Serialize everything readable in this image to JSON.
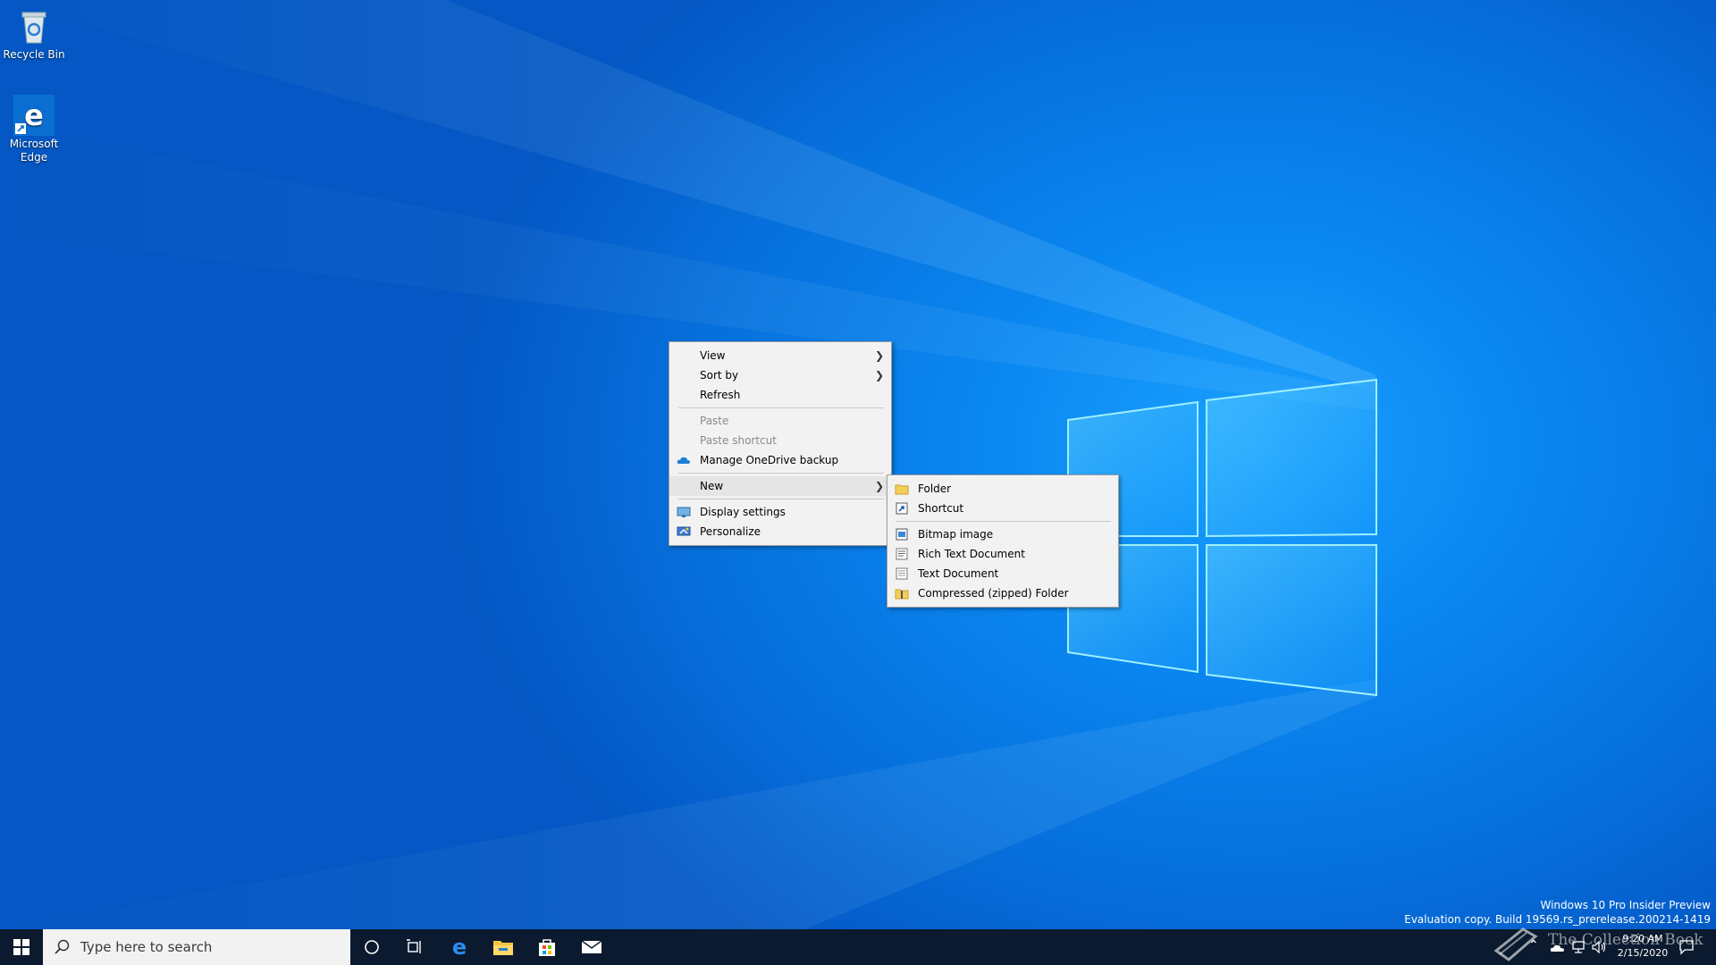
{
  "desktop": {
    "icons": [
      {
        "label": "Recycle Bin",
        "icon": "recycle-bin-icon"
      },
      {
        "label": "Microsoft Edge",
        "icon": "edge-icon"
      }
    ]
  },
  "context_menu": {
    "items": {
      "view": "View",
      "sort_by": "Sort by",
      "refresh": "Refresh",
      "paste": "Paste",
      "paste_shortcut": "Paste shortcut",
      "onedrive": "Manage OneDrive backup",
      "new": "New",
      "display_settings": "Display settings",
      "personalize": "Personalize"
    }
  },
  "new_submenu": {
    "items": {
      "folder": "Folder",
      "shortcut": "Shortcut",
      "bitmap": "Bitmap image",
      "rtf": "Rich Text Document",
      "text": "Text Document",
      "zip": "Compressed (zipped) Folder"
    }
  },
  "taskbar": {
    "search_placeholder": "Type here to search",
    "time": "9:20 AM",
    "date": "2/15/2020"
  },
  "watermark": {
    "line1": "Windows 10 Pro Insider Preview",
    "line2": "Evaluation copy. Build 19569.rs_prerelease.200214-1419"
  },
  "overlay_text": "The Collection Book",
  "colors": {
    "accent": "#0a86f0",
    "taskbar": "#0b1a2e",
    "menu_bg": "#f2f2f2"
  }
}
